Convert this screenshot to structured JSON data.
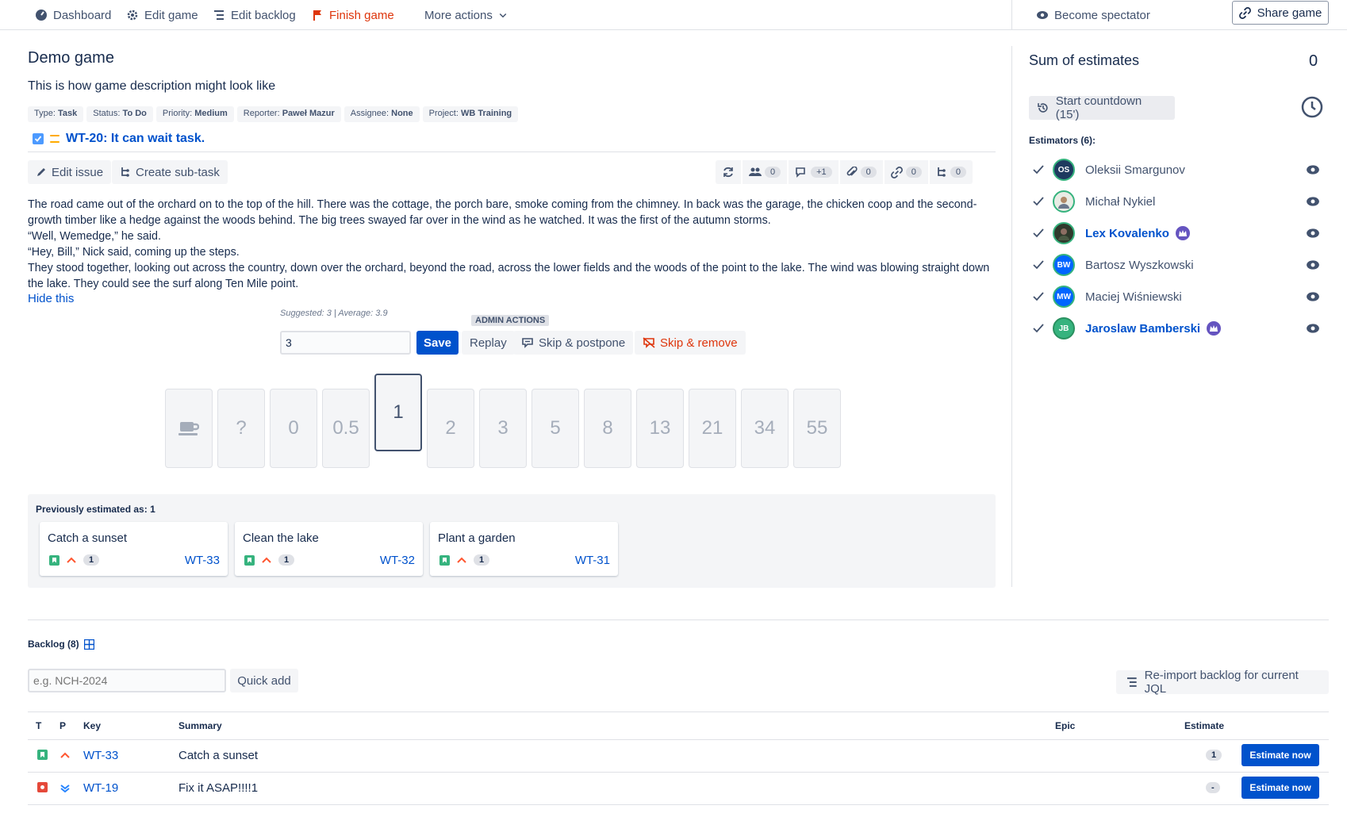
{
  "nav": {
    "dashboard": "Dashboard",
    "edit_game": "Edit game",
    "edit_backlog": "Edit backlog",
    "finish_game": "Finish game",
    "more_actions": "More actions",
    "become_spectator": "Become spectator",
    "share_game": "Share game"
  },
  "game": {
    "title": "Demo game",
    "description": "This is how game description might look like"
  },
  "issue": {
    "meta": [
      {
        "label": "Type:",
        "value": "Task"
      },
      {
        "label": "Status:",
        "value": "To Do"
      },
      {
        "label": "Priority:",
        "value": "Medium"
      },
      {
        "label": "Reporter:",
        "value": "Paweł Mazur"
      },
      {
        "label": "Assignee:",
        "value": "None"
      },
      {
        "label": "Project:",
        "value": "WB Training"
      }
    ],
    "link": "WT-20: It can wait task.",
    "edit_issue": "Edit issue",
    "create_subtask": "Create sub-task",
    "tools": [
      {
        "icon": "refresh-icon",
        "count": ""
      },
      {
        "icon": "people-icon",
        "count": "0"
      },
      {
        "icon": "comment-icon",
        "count": "+1"
      },
      {
        "icon": "attachment-icon",
        "count": "0"
      },
      {
        "icon": "link-icon",
        "count": "0"
      },
      {
        "icon": "subtask-icon",
        "count": "0"
      }
    ],
    "story": [
      "The road came out of the orchard on to the top of the hill. There was the cottage, the porch bare, smoke coming from the chimney. In back was the garage, the chicken coop and the second-growth timber like a hedge against the woods behind. The big trees swayed far over in the wind as he watched. It was the first of the autumn storms.",
      "“Well, Wemedge,” he said.",
      "“Hey, Bill,” Nick said, coming up the steps.",
      "They stood together, looking out across the country, down over the orchard, beyond the road, across the lower fields and the woods of the point to the lake. The wind was blowing straight down the lake. They could see the surf along Ten Mile point."
    ],
    "hide_link": "Hide this"
  },
  "estimate": {
    "suggested": "Suggested: 3 | Average: 3.9",
    "admin_tag": "ADMIN ACTIONS",
    "value": "3",
    "save": "Save",
    "replay": "Replay",
    "skip_postpone": "Skip & postpone",
    "skip_remove": "Skip & remove"
  },
  "cards": [
    "coffee",
    "?",
    "0",
    "0.5",
    "1",
    "2",
    "3",
    "5",
    "8",
    "13",
    "21",
    "34",
    "55"
  ],
  "selected_card": "1",
  "previous": {
    "title": "Previously estimated as: 1",
    "items": [
      {
        "title": "Catch a sunset",
        "key": "WT-33",
        "estimate": "1"
      },
      {
        "title": "Clean the lake",
        "key": "WT-32",
        "estimate": "1"
      },
      {
        "title": "Plant a garden",
        "key": "WT-31",
        "estimate": "1"
      }
    ]
  },
  "sidebar": {
    "sum_title": "Sum of estimates",
    "sum_value": "0",
    "countdown": "Start countdown (15')",
    "estimators_title": "Estimators (6):",
    "estimators": [
      {
        "name": "Oleksii Smargunov",
        "initials": "OS",
        "color": "#1e3a5f",
        "admin": false
      },
      {
        "name": "Michał Nykiel",
        "initials": "",
        "color": "#c9d6c2",
        "admin": false
      },
      {
        "name": "Lex Kovalenko",
        "initials": "",
        "color": "#3d4f3a",
        "admin": true
      },
      {
        "name": "Bartosz Wyszkowski",
        "initials": "BW",
        "color": "#0065ff",
        "admin": false
      },
      {
        "name": "Maciej Wiśniewski",
        "initials": "MW",
        "color": "#0065ff",
        "admin": false
      },
      {
        "name": "Jaroslaw Bamberski",
        "initials": "JB",
        "color": "#36b37e",
        "admin": true
      }
    ]
  },
  "backlog": {
    "title": "Backlog (8)",
    "placeholder": "e.g. NCH-2024",
    "quick_add": "Quick add",
    "reimport": "Re-import backlog for current JQL",
    "headers": {
      "t": "T",
      "p": "P",
      "key": "Key",
      "summary": "Summary",
      "epic": "Epic",
      "estimate": "Estimate"
    },
    "rows": [
      {
        "type": "story",
        "priority": "high",
        "key": "WT-33",
        "summary": "Catch a sunset",
        "estimate": "1",
        "action": "Estimate now"
      },
      {
        "type": "bug",
        "priority": "lowest",
        "key": "WT-19",
        "summary": "Fix it ASAP!!!!1",
        "estimate": "-",
        "action": "Estimate now"
      }
    ]
  }
}
